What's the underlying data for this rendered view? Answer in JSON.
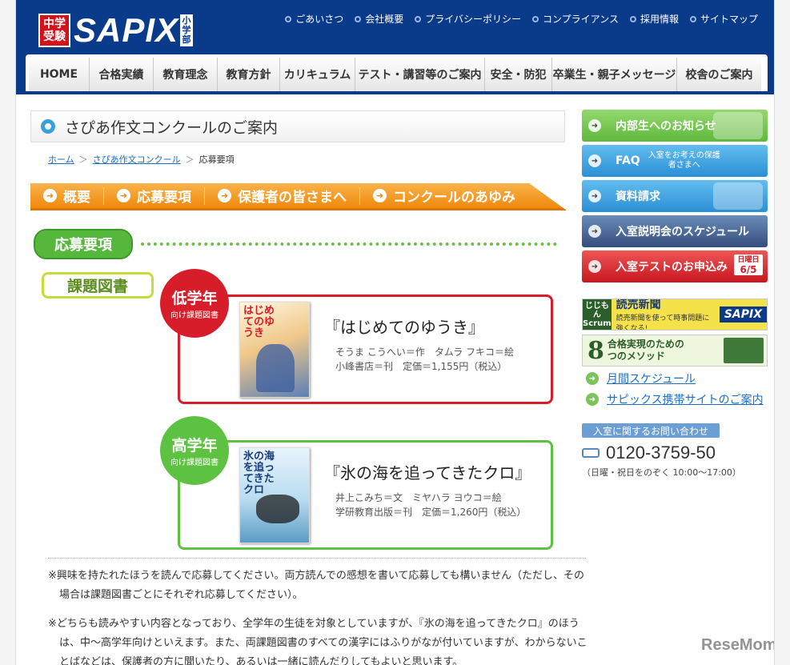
{
  "header": {
    "logo_badge_top": "中学",
    "logo_badge_bottom": "受験",
    "logo_word": "SAPIX",
    "logo_tag": "小学部",
    "utility_links": [
      "ごあいさつ",
      "会社概要",
      "プライバシーポリシー",
      "コンプライアンス",
      "採用情報",
      "サイトマップ"
    ]
  },
  "global_nav": {
    "tabs": [
      "HOME",
      "合格実績",
      "教育理念",
      "教育方針",
      "カリキュラム",
      "テスト・講習等のご案内",
      "安全・防犯",
      "卒業生・親子メッセージ",
      "校舎のご案内"
    ]
  },
  "page_title": "さぴあ作文コンクールのご案内",
  "breadcrumb": {
    "home": "ホーム",
    "section": "さぴあ作文コンクール",
    "current": "応募要項"
  },
  "sub_nav": {
    "items": [
      "概要",
      "応募要項",
      "保護者の皆さまへ",
      "コンクールのあゆみ"
    ]
  },
  "section_heading": "応募要項",
  "kadai_label": "課題図書",
  "books": {
    "lower": {
      "grade": "低学年",
      "grade_sub": "向け課題図書",
      "cover_text": "はじめてのゆうき",
      "title": "『はじめてのゆうき』",
      "author_line": "そうま こうへい＝作　タムラ フキコ＝絵",
      "publisher_line": "小峰書店＝刊　定価＝1,155円（税込）"
    },
    "upper": {
      "grade": "高学年",
      "grade_sub": "向け課題図書",
      "cover_text": "氷の海を追ってきたクロ",
      "title": "『氷の海を追ってきたクロ』",
      "author_line": "井上こみち＝文　ミヤハラ ヨウコ＝絵",
      "publisher_line": "学研教育出版＝刊　定価＝1,260円（税込）"
    }
  },
  "notes": [
    "※興味を持たれたほうを読んで応募してください。両方読んでの感想を書いて応募しても構いません（ただし、その場合は課題図書ごとにそれぞれ応募してください）。",
    "※どちらも読みやすい内容となっており、全学年の生徒を対象としていますが、『氷の海を追ってきたクロ』のほうは、中〜高学年向けといえます。また、両課題図書のすべての漢字にはふりがなが付いていますが、わからないことばなどは、保護者の方に聞いたり、あるいは一緒に読んだりしてもよいと思います。"
  ],
  "sidebar": {
    "buttons": [
      {
        "label": "内部生へのお知らせ",
        "sub": ""
      },
      {
        "label": "FAQ",
        "sub": "入室をお考えの保護者さまへ"
      },
      {
        "label": "資料請求",
        "sub": ""
      },
      {
        "label": "入室説明会のスケジュール",
        "sub": ""
      },
      {
        "label": "入室テストのお申込み",
        "tag_top": "日曜日",
        "tag_date": "6/5"
      }
    ],
    "banner_scrum": {
      "block": "じじもんScrum",
      "title": "読売新聞",
      "caption": "読売新聞を使って時事問題に強くなる!",
      "brand": "SAPIX"
    },
    "banner_method": {
      "number": "8",
      "text_top": "合格実現のための",
      "text_bottom": "つのメソッド"
    },
    "links": [
      "月間スケジュール",
      "サピックス携帯サイトのご案内"
    ],
    "inquiry_label": "入室に関するお問い合わせ",
    "phone": "0120-3759-50",
    "phone_note": "（日曜・祝日をのぞく 10:00〜17:00）"
  },
  "watermark": "ReseMom",
  "colors": {
    "header_blue": "#0a3a8a",
    "orange": "#f08a0c",
    "green": "#55b83c",
    "red": "#d71c2a"
  }
}
